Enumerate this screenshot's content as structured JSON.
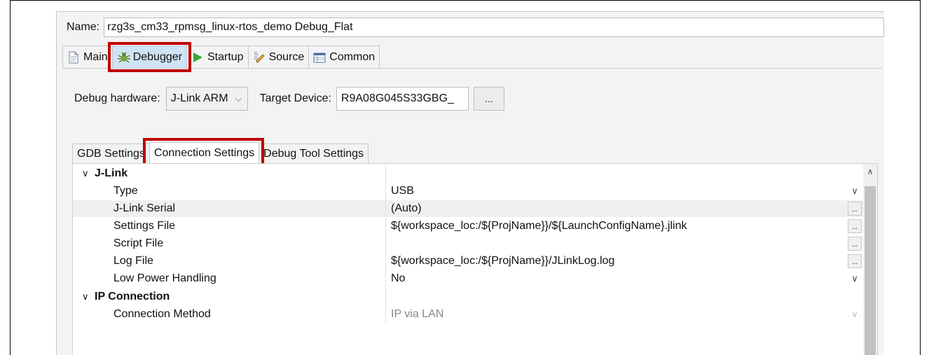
{
  "name": {
    "label": "Name:",
    "value": "rzg3s_cm33_rpmsg_linux-rtos_demo Debug_Flat"
  },
  "tabs": [
    {
      "label": "Main",
      "icon": "document-icon"
    },
    {
      "label": "Debugger",
      "icon": "bug-icon",
      "selected": true
    },
    {
      "label": "Startup",
      "icon": "play-icon"
    },
    {
      "label": "Source",
      "icon": "source-icon"
    },
    {
      "label": "Common",
      "icon": "common-icon"
    }
  ],
  "hardware": {
    "label": "Debug hardware:",
    "value": "J-Link ARM",
    "target_label": "Target Device:",
    "target_value": "R9A08G045S33GBG_",
    "browse_label": "..."
  },
  "inner_tabs": [
    {
      "label": "GDB Settings"
    },
    {
      "label": "Connection Settings",
      "selected": true
    },
    {
      "label": "Debug Tool Settings"
    }
  ],
  "table": {
    "groups": [
      {
        "label": "J-Link",
        "rows": [
          {
            "name": "Type",
            "value": "USB",
            "control": "dropdown"
          },
          {
            "name": "J-Link Serial",
            "value": "(Auto)",
            "control": "browse"
          },
          {
            "name": "Settings File",
            "value": "${workspace_loc:/${ProjName}}/${LaunchConfigName}.jlink",
            "control": "browse"
          },
          {
            "name": "Script File",
            "value": "",
            "control": "browse"
          },
          {
            "name": "Log File",
            "value": "${workspace_loc:/${ProjName}}/JLinkLog.log",
            "control": "browse"
          },
          {
            "name": "Low Power Handling",
            "value": "No",
            "control": "dropdown"
          }
        ]
      },
      {
        "label": "IP Connection",
        "rows": [
          {
            "name": "Connection Method",
            "value": "IP via LAN",
            "control": "dropdown",
            "disabled": true
          }
        ]
      }
    ],
    "browse_label": "..."
  },
  "colors": {
    "highlight": "#c00000",
    "selected_tab": "#cfe3f6"
  }
}
